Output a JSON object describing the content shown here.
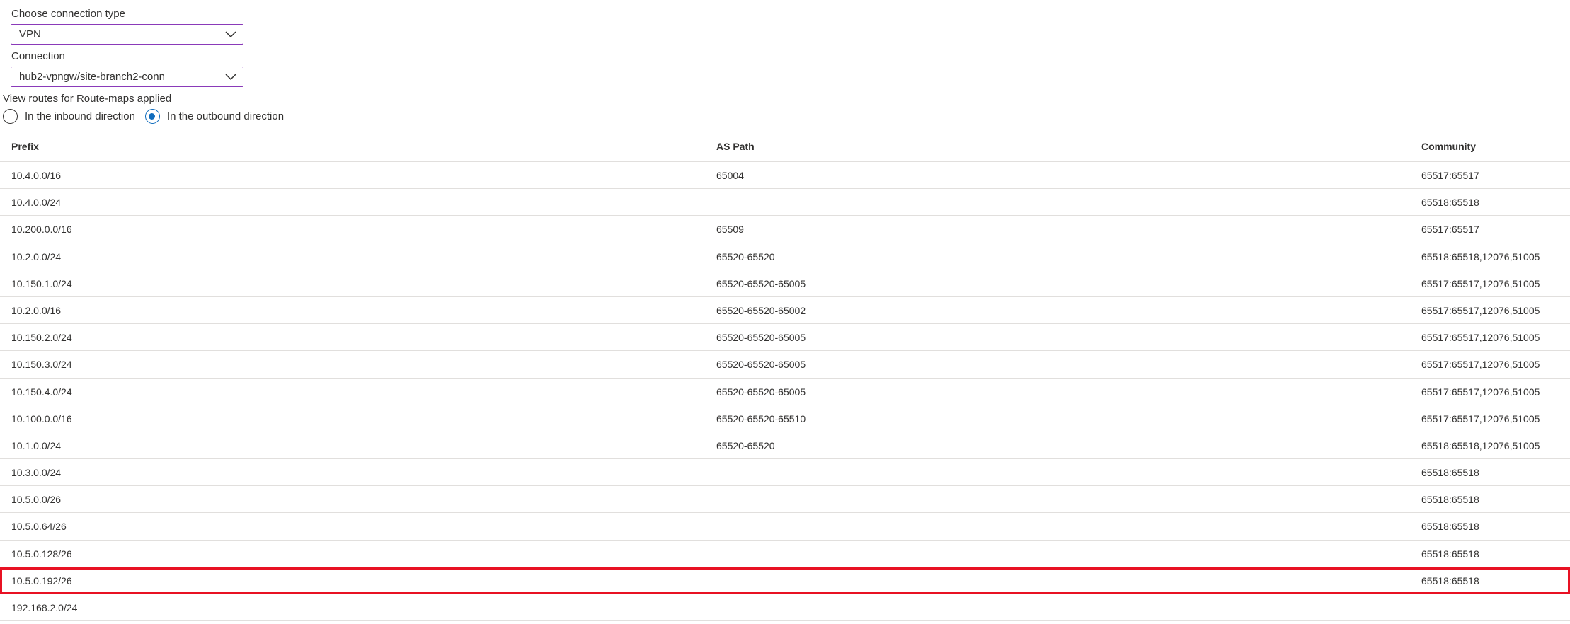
{
  "connection_type": {
    "label": "Choose connection type",
    "value": "VPN"
  },
  "connection": {
    "label": "Connection",
    "value": "hub2-vpngw/site-branch2-conn"
  },
  "route_maps": {
    "label": "View routes for Route-maps applied",
    "options": [
      {
        "label": "In the inbound direction",
        "checked": false
      },
      {
        "label": "In the outbound direction",
        "checked": true
      }
    ]
  },
  "table": {
    "headers": [
      "Prefix",
      "AS Path",
      "Community"
    ],
    "rows": [
      [
        "10.4.0.0/16",
        "65004",
        "65517:65517"
      ],
      [
        "10.4.0.0/24",
        "",
        "65518:65518"
      ],
      [
        "10.200.0.0/16",
        "65509",
        "65517:65517"
      ],
      [
        "10.2.0.0/24",
        "65520-65520",
        "65518:65518,12076,51005"
      ],
      [
        "10.150.1.0/24",
        "65520-65520-65005",
        "65517:65517,12076,51005"
      ],
      [
        "10.2.0.0/16",
        "65520-65520-65002",
        "65517:65517,12076,51005"
      ],
      [
        "10.150.2.0/24",
        "65520-65520-65005",
        "65517:65517,12076,51005"
      ],
      [
        "10.150.3.0/24",
        "65520-65520-65005",
        "65517:65517,12076,51005"
      ],
      [
        "10.150.4.0/24",
        "65520-65520-65005",
        "65517:65517,12076,51005"
      ],
      [
        "10.100.0.0/16",
        "65520-65520-65510",
        "65517:65517,12076,51005"
      ],
      [
        "10.1.0.0/24",
        "65520-65520",
        "65518:65518,12076,51005"
      ],
      [
        "10.3.0.0/24",
        "",
        "65518:65518"
      ],
      [
        "10.5.0.0/26",
        "",
        "65518:65518"
      ],
      [
        "10.5.0.64/26",
        "",
        "65518:65518"
      ],
      [
        "10.5.0.128/26",
        "",
        "65518:65518"
      ],
      [
        "10.5.0.192/26",
        "",
        "65518:65518"
      ],
      [
        "192.168.2.0/24",
        "",
        ""
      ]
    ],
    "highlighted_row": 15,
    "highlight_color": "#e81123"
  }
}
